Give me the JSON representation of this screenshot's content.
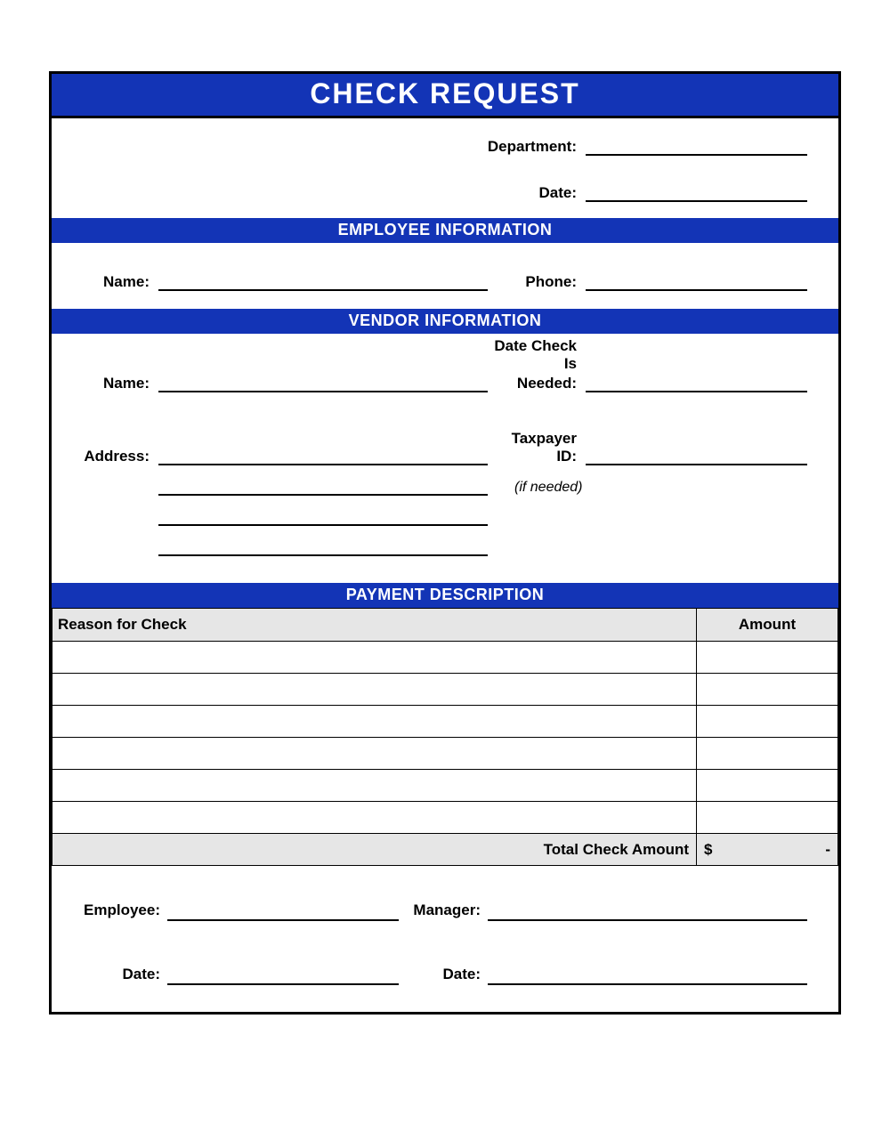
{
  "title": "CHECK REQUEST",
  "header": {
    "department_label": "Department:",
    "date_label": "Date:"
  },
  "sections": {
    "employee_title": "EMPLOYEE INFORMATION",
    "vendor_title": "VENDOR INFORMATION",
    "payment_title": "PAYMENT DESCRIPTION"
  },
  "employee": {
    "name_label": "Name:",
    "phone_label": "Phone:"
  },
  "vendor": {
    "name_label": "Name:",
    "date_needed_label_line1": "Date Check Is",
    "date_needed_label_line2": "Needed:",
    "address_label": "Address:",
    "taxpayer_label": "Taxpayer ID:",
    "taxpayer_hint": "(if needed)"
  },
  "payment": {
    "reason_header": "Reason for Check",
    "amount_header": "Amount",
    "total_label": "Total Check Amount",
    "total_currency": "$",
    "total_value": "-"
  },
  "signatures": {
    "employee_label": "Employee:",
    "manager_label": "Manager:",
    "date_label": "Date:"
  }
}
